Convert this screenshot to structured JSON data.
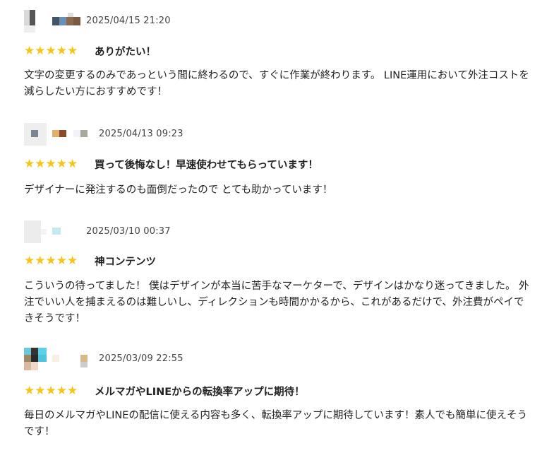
{
  "colors": {
    "star": "#f5c518",
    "text": "#222222",
    "date": "#444444"
  },
  "reviews": [
    {
      "date": "2025/04/15 21:20",
      "stars": "★★★★★",
      "rating": 5,
      "title": "ありがたい！",
      "body": "文字の変更するのみであっという間に終わるので、すぐに作業が終わります。 LINE運用において外注コストを減らしたい方におすすめです！"
    },
    {
      "date": "2025/04/13 09:23",
      "stars": "★★★★★",
      "rating": 5,
      "title": "買って後悔なし！早速使わせてもらっています！",
      "body": "デザイナーに発注するのも面倒だったので とても助かっています！"
    },
    {
      "date": "2025/03/10 00:37",
      "stars": "★★★★★",
      "rating": 5,
      "title": "神コンテンツ",
      "body": "こういうの待ってました！ 僕はデザインが本当に苦手なマーケターで、デザインはかなり迷ってきました。 外注でいい人を捕まえるのは難しいし、ディレクションも時間かかるから、これがあるだけで、外注費がペイできそうです！"
    },
    {
      "date": "2025/03/09 22:55",
      "stars": "★★★★★",
      "rating": 5,
      "title": "メルマガやLINEからの転換率アップに期待！",
      "body": "毎日のメルマガやLINEの配信に使える内容も多く、転換率アップに期待しています！素人でも簡単に使えそうです！"
    }
  ]
}
